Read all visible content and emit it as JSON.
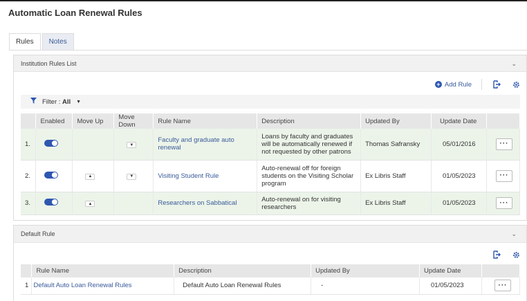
{
  "page": {
    "title": "Automatic Loan Renewal Rules"
  },
  "tabs": [
    {
      "label": "Rules",
      "active": true
    },
    {
      "label": "Notes",
      "active": false
    }
  ],
  "institution": {
    "header": "Institution Rules List",
    "add_rule_label": "Add Rule",
    "filter_label": "Filter :",
    "filter_value": "All",
    "columns": [
      "Enabled",
      "Move Up",
      "Move Down",
      "Rule Name",
      "Description",
      "Updated By",
      "Update Date"
    ],
    "rows": [
      {
        "index": "1.",
        "enabled": true,
        "move_up": false,
        "move_down": true,
        "name": "Faculty and graduate auto renewal",
        "description": "Loans by faculty and graduates will be automatically renewed if not requested by other patrons",
        "updated_by": "Thomas Safransky",
        "update_date": "05/01/2016"
      },
      {
        "index": "2.",
        "enabled": true,
        "move_up": true,
        "move_down": true,
        "name": "Visiting Student Rule",
        "description": "Auto-renewal off for foreign students on the Visiting Scholar program",
        "updated_by": "Ex Libris Staff",
        "update_date": "01/05/2023"
      },
      {
        "index": "3.",
        "enabled": true,
        "move_up": true,
        "move_down": false,
        "name": "Researchers on Sabbatical",
        "description": "Auto-renewal on for visiting researchers",
        "updated_by": "Ex Libris Staff",
        "update_date": "01/05/2023"
      }
    ]
  },
  "default": {
    "header": "Default Rule",
    "columns": [
      "Rule Name",
      "Description",
      "Updated By",
      "Update Date"
    ],
    "rows": [
      {
        "index": "1",
        "name": "Default Auto Loan Renewal Rules",
        "description": "Default Auto Loan Renewal Rules",
        "updated_by": "-",
        "update_date": "01/05/2023"
      }
    ]
  },
  "icons": {
    "accent": "#2e57b0",
    "export": "export-icon",
    "settings": "gear-icon",
    "filter": "filter-icon",
    "more": "more-actions-icon"
  }
}
